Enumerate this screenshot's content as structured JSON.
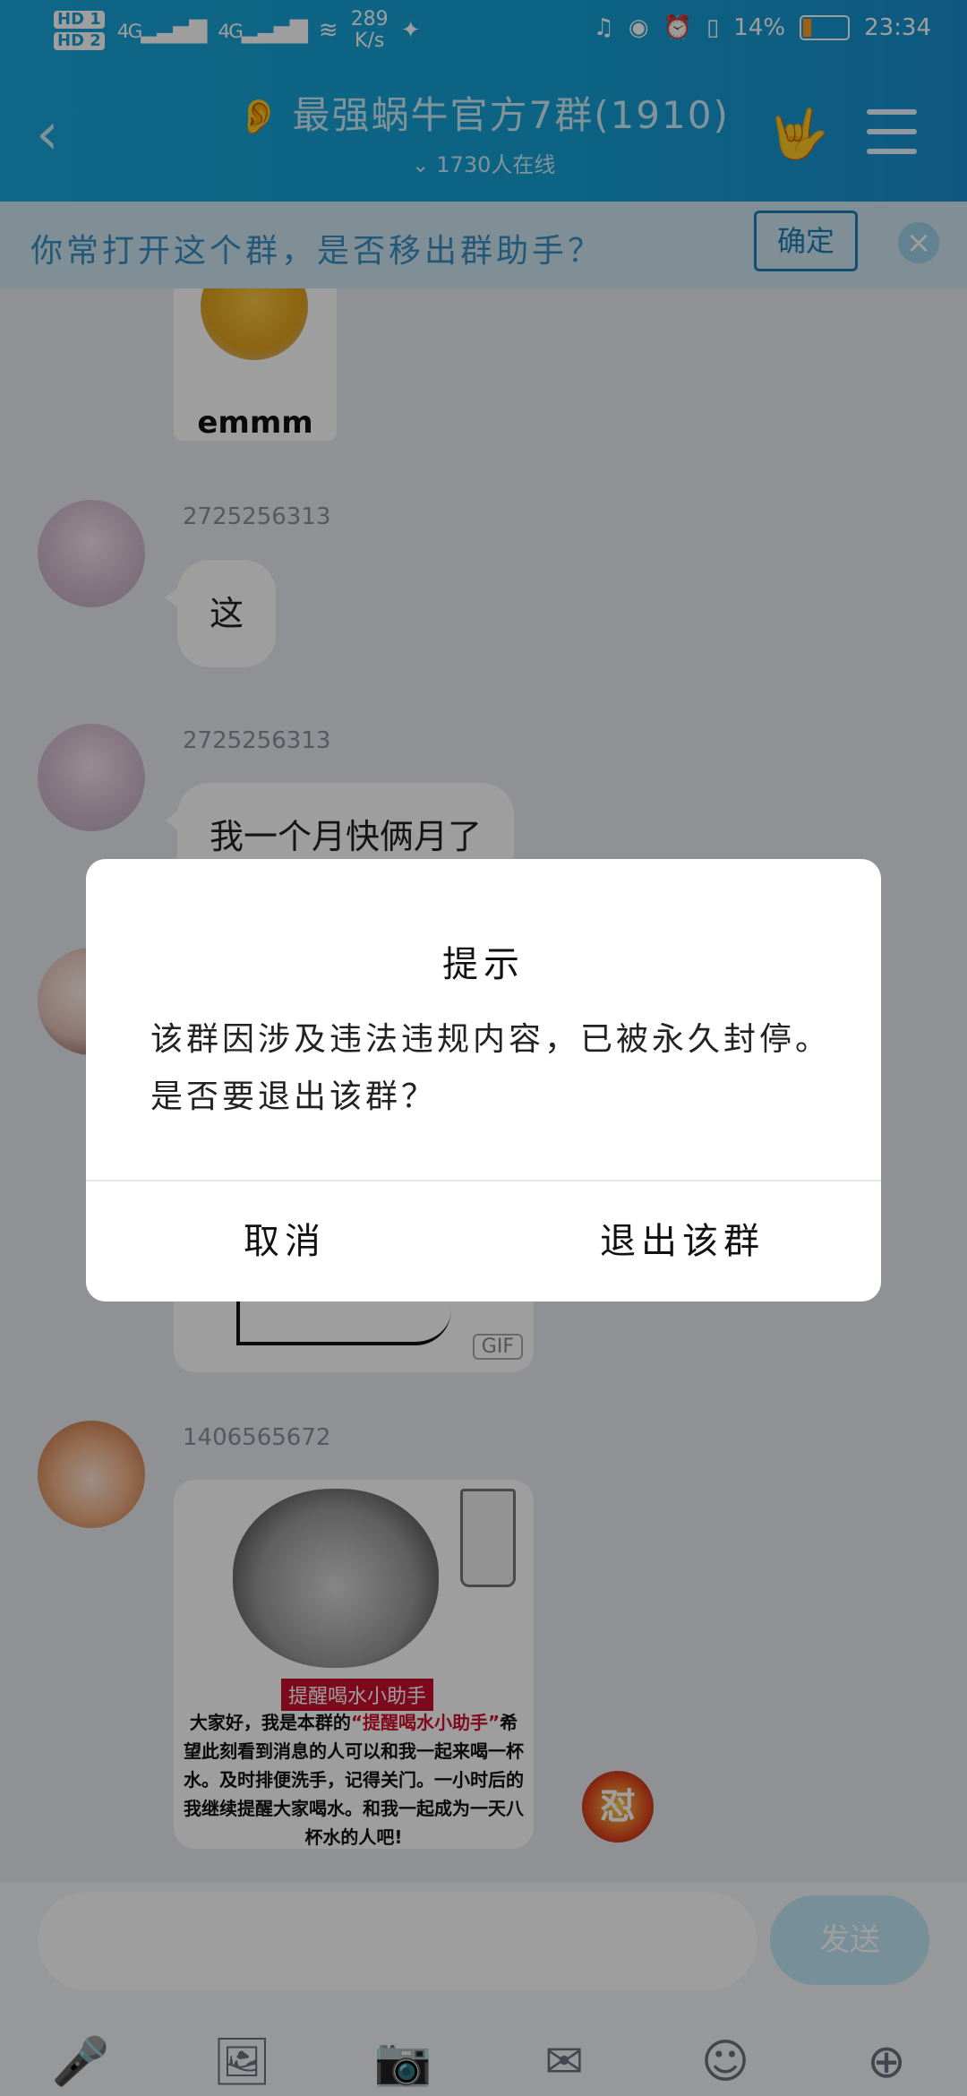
{
  "status_bar": {
    "hd1": "HD 1",
    "hd2": "HD 2",
    "net1": "4G",
    "net2": "4G",
    "speed_value": "289",
    "speed_unit": "K/s",
    "battery": "14%",
    "time": "23:34"
  },
  "header": {
    "back_icon": "chevron-left-icon",
    "title": "最强蜗牛官方7群(1910)",
    "subtitle": "1730人在线",
    "hand_icon": "hand-gesture-icon",
    "menu_icon": "menu-icon"
  },
  "notice": {
    "text": "你常打开这个群，是否移出群助手？",
    "confirm_label": "确定",
    "close_icon": "close-icon"
  },
  "messages": [
    {
      "sticker_text": "emmm"
    },
    {
      "sender": "2725256313",
      "text": "这"
    },
    {
      "sender": "2725256313",
      "text": "我一个月快俩月了"
    },
    {
      "gif_badge": "GIF"
    },
    {
      "sender": "1406565672",
      "panda_label": "提醒喝水小助手",
      "panda_text_1": "大家好，我是本群的",
      "panda_text_hl": "“提醒喝水小助手”",
      "panda_text_2": "希望此刻看到消息的人可以和我一起来喝一杯水。及时排便洗手，记得关门。一小时后的我继续提醒大家喝水。和我一起成为一天八杯水的人吧!",
      "fight_label": "怼"
    }
  ],
  "input_bar": {
    "placeholder": "",
    "send_label": "发送",
    "tools": [
      "microphone-icon",
      "image-icon",
      "camera-icon",
      "red-packet-icon",
      "emoji-icon",
      "plus-icon"
    ]
  },
  "dialog": {
    "title": "提示",
    "body": "该群因涉及违法违规内容，已被永久封停。是否要退出该群？",
    "cancel_label": "取消",
    "exit_label": "退出该群"
  },
  "colors": {
    "header": "#14a0d4",
    "notice_bg": "#cfe7f3",
    "notice_text": "#3a8fc2",
    "confirm_border": "#1e7eb8",
    "send_button": "#bfe7f7"
  }
}
